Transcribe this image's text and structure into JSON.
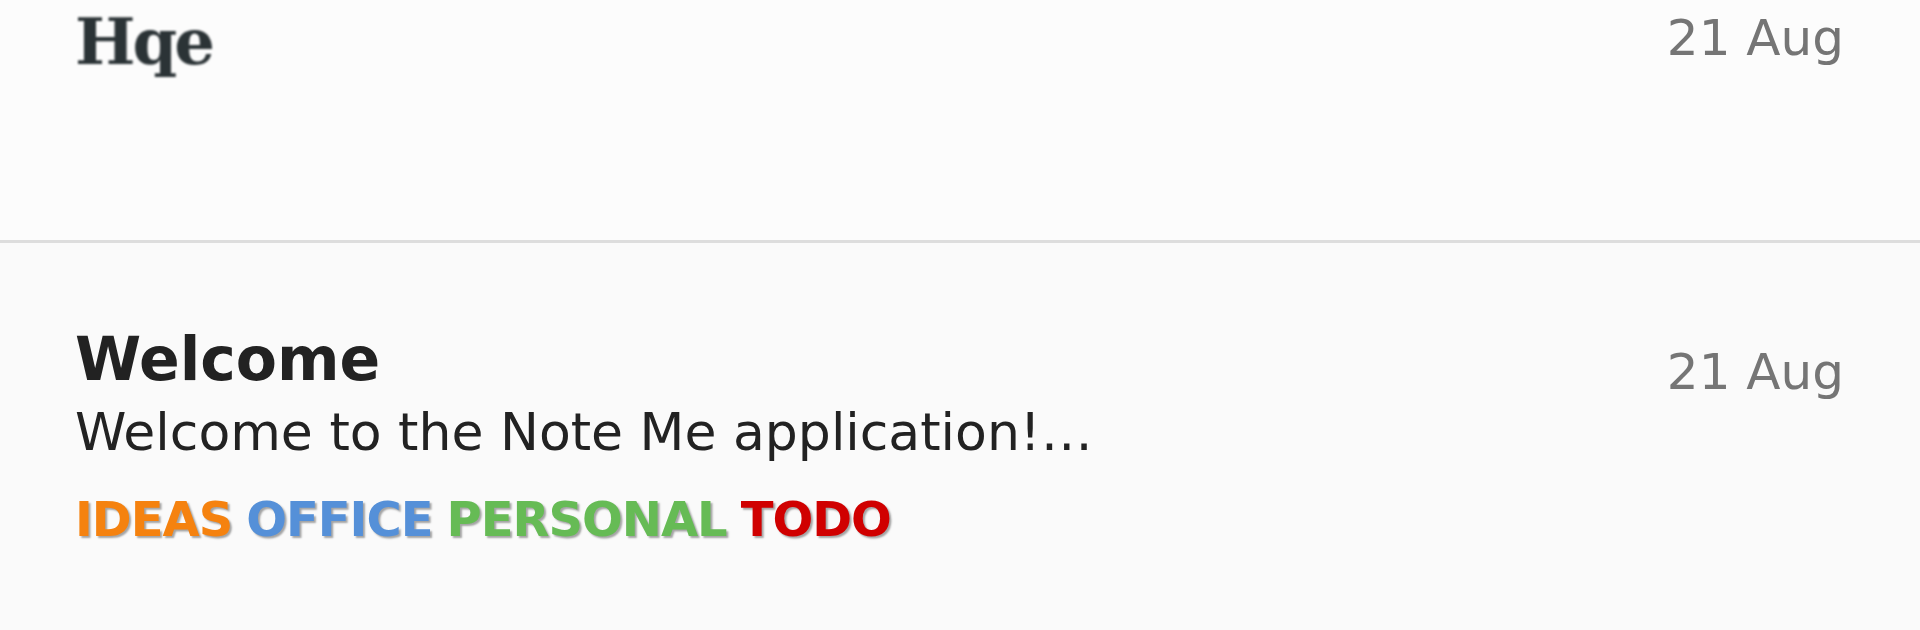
{
  "notes": [
    {
      "kind": "sketch",
      "title": "Hqe",
      "date": "21 Aug"
    },
    {
      "kind": "text",
      "title": "Welcome",
      "date": "21 Aug",
      "preview": "Welcome to the Note Me application!…",
      "tags": [
        {
          "label": "IDEAS",
          "color": "#f5820f"
        },
        {
          "label": "OFFICE",
          "color": "#5590d8"
        },
        {
          "label": "PERSONAL",
          "color": "#66bb55"
        },
        {
          "label": "TODO",
          "color": "#d00000"
        }
      ]
    }
  ]
}
